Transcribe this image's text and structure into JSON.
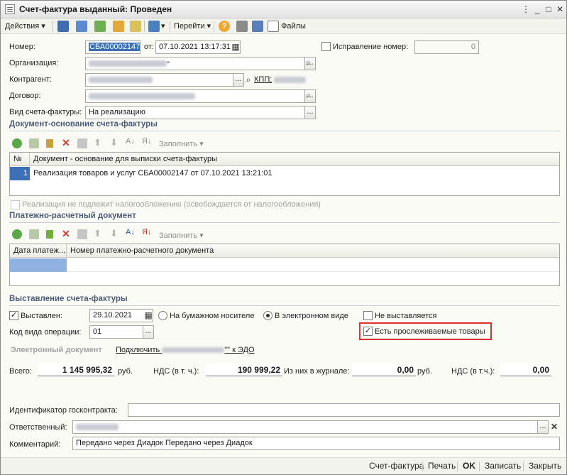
{
  "window": {
    "title": "Счет-фактура выданный: Проведен"
  },
  "toolbar": {
    "actions_label": "Действия",
    "goto_label": "Перейти",
    "files_label": "Файлы",
    "help_label": "?"
  },
  "header": {
    "number_label": "Номер:",
    "number_value": "СБА00002147",
    "date_label": "от:",
    "date_value": "07.10.2021 13:17:31",
    "correction_label": "Исправление номер:",
    "correction_value": "0",
    "org_label": "Организация:",
    "org_value_suffix": "\"",
    "contragent_label": "Контрагент:",
    "kpp_label": "КПП:",
    "contract_label": "Договор:",
    "invoice_type_label": "Вид счета-фактуры:",
    "invoice_type_value": "На реализацию"
  },
  "basis_section": {
    "title": "Документ-основание счета-фактуры",
    "fill_label": "Заполнить",
    "col_num": "№",
    "col_doc": "Документ - основание для выписки счета-фактуры",
    "rows": [
      {
        "num": "1",
        "doc": "Реализация товаров и услуг СБА00002147 от 07.10.2021 13:21:01"
      }
    ],
    "not_taxable_label": "Реализация не подлежит налогообложению (освобождается от налогообложения)"
  },
  "payment_section": {
    "title": "Платежно-расчетный документ",
    "fill_label": "Заполнить",
    "col_date": "Дата платеж...",
    "col_num": "Номер платежно-расчетного документа"
  },
  "issue_section": {
    "title": "Выставление счета-фактуры",
    "issued_label": "Выставлен:",
    "issued_date": "29.10.2021",
    "paper_label": "На бумажном носителе",
    "electronic_label": "В электронном виде",
    "not_issued_label": "Не выставляется",
    "traceable_label": "Есть прослеживаемые товары",
    "op_code_label": "Код вида операции:",
    "op_code_value": "01",
    "edoc_label": "Электронный документ",
    "connect_link_prefix": "Подключить",
    "connect_link_suffix": "\"\" к ЭДО"
  },
  "totals": {
    "total_label": "Всего:",
    "total_value": "1 145 995,32",
    "total_unit": "руб.",
    "vat_label": "НДС (в т. ч.):",
    "vat_value": "190 999,22",
    "journal_label": "Из них в журнале:",
    "journal_value": "0,00",
    "journal_unit": "руб.",
    "vat2_label": "НДС (в т.ч.):",
    "vat2_value": "0,00"
  },
  "footer_fields": {
    "contract_id_label": "Идентификатор госконтракта:",
    "responsible_label": "Ответственный:",
    "comment_label": "Комментарий:",
    "comment_value": "Передано через Диадок Передано через Диадок"
  },
  "bottom_bar": {
    "invoice_btn": "Счет-фактура",
    "print_btn": "Печать",
    "ok_btn": "OK",
    "save_btn": "Записать",
    "close_btn": "Закрыть"
  },
  "colors": {
    "accent": "#3b6fb6",
    "section_title": "#4c5c78",
    "highlight_box": "#e0302f"
  }
}
